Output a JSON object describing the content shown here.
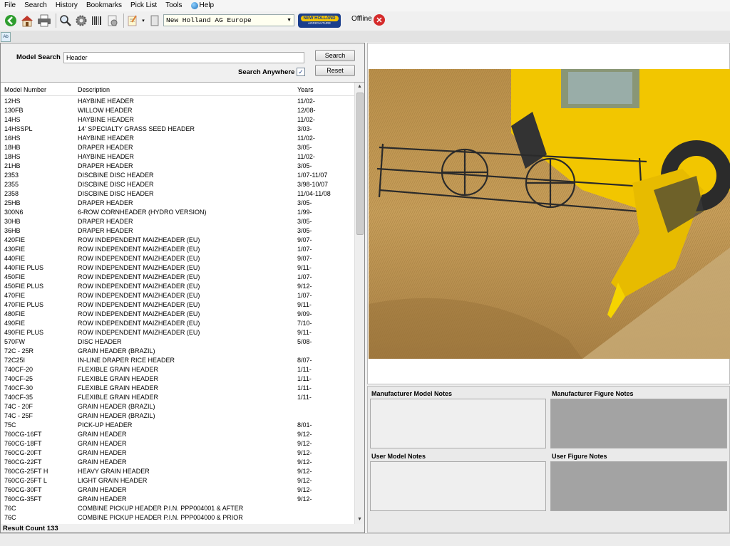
{
  "menu": {
    "items": [
      "File",
      "Search",
      "History",
      "Bookmarks",
      "Pick List",
      "Tools"
    ],
    "help_label": "Help"
  },
  "toolbar": {
    "catalog": "New Holland AG Europe",
    "logo_brand": "NEW HOLLAND",
    "logo_sub": "AGRICULTURE",
    "offline_label": "Offline"
  },
  "search": {
    "label": "Model Search",
    "value": "Header",
    "search_button": "Search",
    "reset_button": "Reset",
    "anywhere_label": "Search Anywhere",
    "anywhere_checked": true
  },
  "grid": {
    "columns": [
      "Model Number",
      "Description",
      "Years"
    ],
    "rows": [
      [
        "12HS",
        "HAYBINE HEADER",
        "11/02-"
      ],
      [
        "130FB",
        "WILLOW HEADER",
        "12/08-"
      ],
      [
        "14HS",
        "HAYBINE HEADER",
        "11/02-"
      ],
      [
        "14HSSPL",
        "14' SPECIALTY GRASS SEED HEADER",
        "3/03-"
      ],
      [
        "16HS",
        "HAYBINE HEADER",
        "11/02-"
      ],
      [
        "18HB",
        "DRAPER HEADER",
        "3/05-"
      ],
      [
        "18HS",
        "HAYBINE HEADER",
        "11/02-"
      ],
      [
        "21HB",
        "DRAPER HEADER",
        "3/05-"
      ],
      [
        "2353",
        "DISCBINE DISC HEADER",
        "1/07-11/07"
      ],
      [
        "2355",
        "DISCBINE DISC HEADER",
        "3/98-10/07"
      ],
      [
        "2358",
        "DISCBINE DISC HEADER",
        "11/04-11/08"
      ],
      [
        "25HB",
        "DRAPER HEADER",
        "3/05-"
      ],
      [
        "300N6",
        "6-ROW CORNHEADER (HYDRO VERSION)",
        "1/99-"
      ],
      [
        "30HB",
        "DRAPER HEADER",
        "3/05-"
      ],
      [
        "36HB",
        "DRAPER HEADER",
        "3/05-"
      ],
      [
        "420FIE",
        "ROW INDEPENDENT MAIZHEADER (EU)",
        "9/07-"
      ],
      [
        "430FIE",
        "ROW INDEPENDENT MAIZHEADER (EU)",
        "1/07-"
      ],
      [
        "440FIE",
        "ROW INDEPENDENT MAIZHEADER (EU)",
        "9/07-"
      ],
      [
        "440FIE PLUS",
        "ROW INDEPENDENT MAIZHEADER (EU)",
        "9/11-"
      ],
      [
        "450FIE",
        "ROW INDEPENDENT MAIZHEADER (EU)",
        "1/07-"
      ],
      [
        "450FIE PLUS",
        "ROW INDEPENDENT MAIZHEADER (EU)",
        "9/12-"
      ],
      [
        "470FIE",
        "ROW INDEPENDENT MAIZHEADER (EU)",
        "1/07-"
      ],
      [
        "470FIE PLUS",
        "ROW INDEPENDENT MAIZHEADER (EU)",
        "9/11-"
      ],
      [
        "480FIE",
        "ROW INDEPENDENT MAIZHEADER (EU)",
        "9/09-"
      ],
      [
        "490FIE",
        "ROW INDEPENDENT MAIZHEADER (EU)",
        "7/10-"
      ],
      [
        "490FIE PLUS",
        "ROW INDEPENDENT MAIZHEADER (EU)",
        "9/11-"
      ],
      [
        "570FW",
        "DISC HEADER",
        "5/08-"
      ],
      [
        "72C - 25R",
        "GRAIN HEADER (BRAZIL)",
        ""
      ],
      [
        "72C25I",
        "IN-LINE DRAPER RICE HEADER",
        "8/07-"
      ],
      [
        "740CF-20",
        "FLEXIBLE GRAIN HEADER",
        "1/11-"
      ],
      [
        "740CF-25",
        "FLEXIBLE GRAIN HEADER",
        "1/11-"
      ],
      [
        "740CF-30",
        "FLEXIBLE GRAIN HEADER",
        "1/11-"
      ],
      [
        "740CF-35",
        "FLEXIBLE GRAIN HEADER",
        "1/11-"
      ],
      [
        "74C - 20F",
        "GRAIN HEADER (BRAZIL)",
        ""
      ],
      [
        "74C - 25F",
        "GRAIN HEADER (BRAZIL)",
        ""
      ],
      [
        "75C",
        "PICK-UP HEADER",
        "8/01-"
      ],
      [
        "760CG-16FT",
        "GRAIN HEADER",
        "9/12-"
      ],
      [
        "760CG-18FT",
        "GRAIN HEADER",
        "9/12-"
      ],
      [
        "760CG-20FT",
        "GRAIN HEADER",
        "9/12-"
      ],
      [
        "760CG-22FT",
        "GRAIN HEADER",
        "9/12-"
      ],
      [
        "760CG-25FT H",
        "HEAVY GRAIN HEADER",
        "9/12-"
      ],
      [
        "760CG-25FT L",
        "LIGHT GRAIN HEADER",
        "9/12-"
      ],
      [
        "760CG-30FT",
        "GRAIN HEADER",
        "9/12-"
      ],
      [
        "760CG-35FT",
        "GRAIN HEADER",
        "9/12-"
      ],
      [
        "76C",
        "COMBINE PICKUP HEADER  P.I.N. PPP004001 & AFTER",
        ""
      ],
      [
        "76C",
        "COMBINE PICKUP HEADER  P.I.N. PPP004000 & PRIOR",
        ""
      ]
    ]
  },
  "result_count_label": "Result Count",
  "result_count": "133",
  "notes": {
    "manufacturer_model": "Manufacturer Model Notes",
    "manufacturer_figure": "Manufacturer Figure Notes",
    "user_model": "User Model Notes",
    "user_figure": "User Figure Notes"
  },
  "colors": {
    "accent_yellow": "#f4c400",
    "brand_blue": "#1a3e8c",
    "offline_red": "#d52b2b"
  }
}
